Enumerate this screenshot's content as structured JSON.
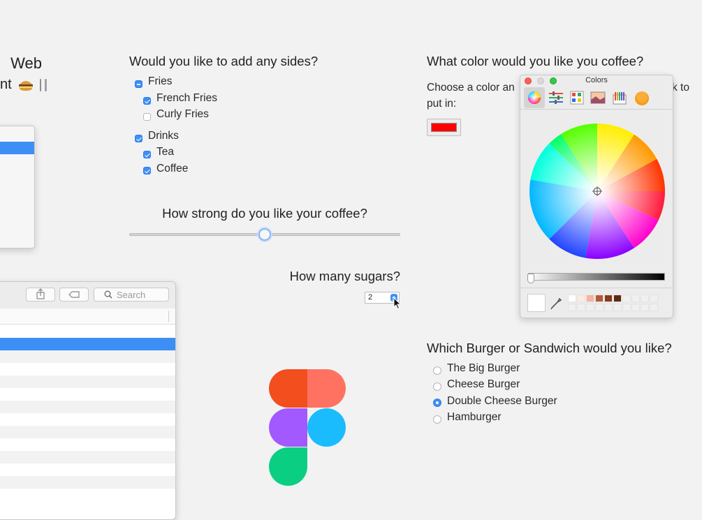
{
  "left_title": {
    "line1": "Web",
    "line2": "nt"
  },
  "sides": {
    "question": "Would you like to add any sides?",
    "groups": [
      {
        "label": "Fries",
        "state": "mixed",
        "items": [
          {
            "label": "French Fries",
            "checked": true
          },
          {
            "label": "Curly Fries",
            "checked": false
          }
        ]
      },
      {
        "label": "Drinks",
        "state": "checked",
        "items": [
          {
            "label": "Tea",
            "checked": true
          },
          {
            "label": "Coffee",
            "checked": true
          }
        ]
      }
    ]
  },
  "strength": {
    "question": "How strong do you like your coffee?",
    "level": 0.5
  },
  "sugars": {
    "question": "How many sugars?",
    "value": "2"
  },
  "color_q": {
    "question": "What color would you like you coffee?",
    "prompt_left": "Choose a color an",
    "prompt_right": "k to",
    "prompt_line2": "put in:",
    "selected_color": "#ff0000"
  },
  "color_panel": {
    "title": "Colors",
    "tabs": [
      "color-wheel-tab-icon",
      "color-sliders-tab-icon",
      "color-palettes-tab-icon",
      "image-palettes-tab-icon",
      "crayons-tab-icon",
      "pencils-extra-tab-icon"
    ]
  },
  "finder": {
    "search_placeholder": "Search"
  },
  "burger": {
    "question": "Which Burger or Sandwich would you like?",
    "options": [
      {
        "label": "The Big Burger",
        "selected": false
      },
      {
        "label": "Cheese Burger",
        "selected": false
      },
      {
        "label": "Double Cheese Burger",
        "selected": true
      },
      {
        "label": "Hamburger",
        "selected": false
      }
    ]
  },
  "colors": {
    "accent": "#3d8ff5",
    "selection": "#3d8ff5"
  }
}
